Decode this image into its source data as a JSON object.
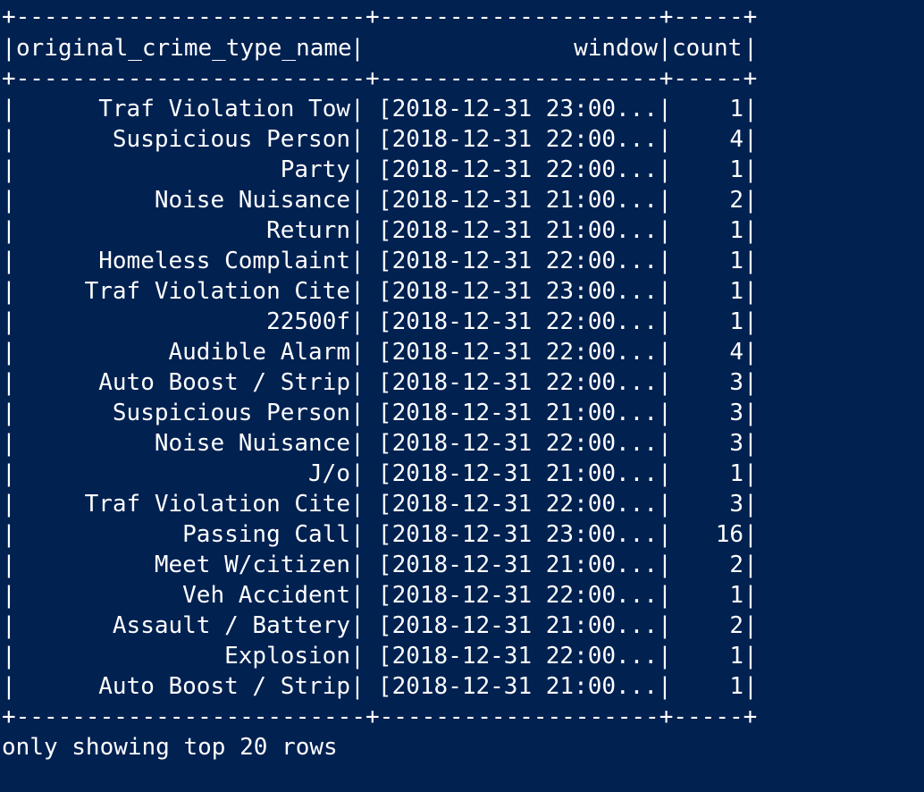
{
  "table": {
    "border": "+-------------------------+--------------------+-----+",
    "headers": {
      "col1": "original_crime_type_name",
      "col2": "window",
      "col3": "count"
    },
    "rows": [
      {
        "type": "Traf Violation Tow",
        "window": "[2018-12-31 23:00...",
        "count": "1"
      },
      {
        "type": "Suspicious Person",
        "window": "[2018-12-31 22:00...",
        "count": "4"
      },
      {
        "type": "Party",
        "window": "[2018-12-31 22:00...",
        "count": "1"
      },
      {
        "type": "Noise Nuisance",
        "window": "[2018-12-31 21:00...",
        "count": "2"
      },
      {
        "type": "Return",
        "window": "[2018-12-31 21:00...",
        "count": "1"
      },
      {
        "type": "Homeless Complaint",
        "window": "[2018-12-31 22:00...",
        "count": "1"
      },
      {
        "type": "Traf Violation Cite",
        "window": "[2018-12-31 23:00...",
        "count": "1"
      },
      {
        "type": "22500f",
        "window": "[2018-12-31 22:00...",
        "count": "1"
      },
      {
        "type": "Audible Alarm",
        "window": "[2018-12-31 22:00...",
        "count": "4"
      },
      {
        "type": "Auto Boost / Strip",
        "window": "[2018-12-31 22:00...",
        "count": "3"
      },
      {
        "type": "Suspicious Person",
        "window": "[2018-12-31 21:00...",
        "count": "3"
      },
      {
        "type": "Noise Nuisance",
        "window": "[2018-12-31 22:00...",
        "count": "3"
      },
      {
        "type": "J/o",
        "window": "[2018-12-31 21:00...",
        "count": "1"
      },
      {
        "type": "Traf Violation Cite",
        "window": "[2018-12-31 22:00...",
        "count": "3"
      },
      {
        "type": "Passing Call",
        "window": "[2018-12-31 23:00...",
        "count": "16"
      },
      {
        "type": "Meet W/citizen",
        "window": "[2018-12-31 21:00...",
        "count": "2"
      },
      {
        "type": "Veh Accident",
        "window": "[2018-12-31 22:00...",
        "count": "1"
      },
      {
        "type": "Assault / Battery",
        "window": "[2018-12-31 21:00...",
        "count": "2"
      },
      {
        "type": "Explosion",
        "window": "[2018-12-31 22:00...",
        "count": "1"
      },
      {
        "type": "Auto Boost / Strip",
        "window": "[2018-12-31 21:00...",
        "count": "1"
      }
    ]
  },
  "footer": "only showing top 20 rows",
  "colors": {
    "background": "#012151",
    "text": "#ffffff"
  }
}
